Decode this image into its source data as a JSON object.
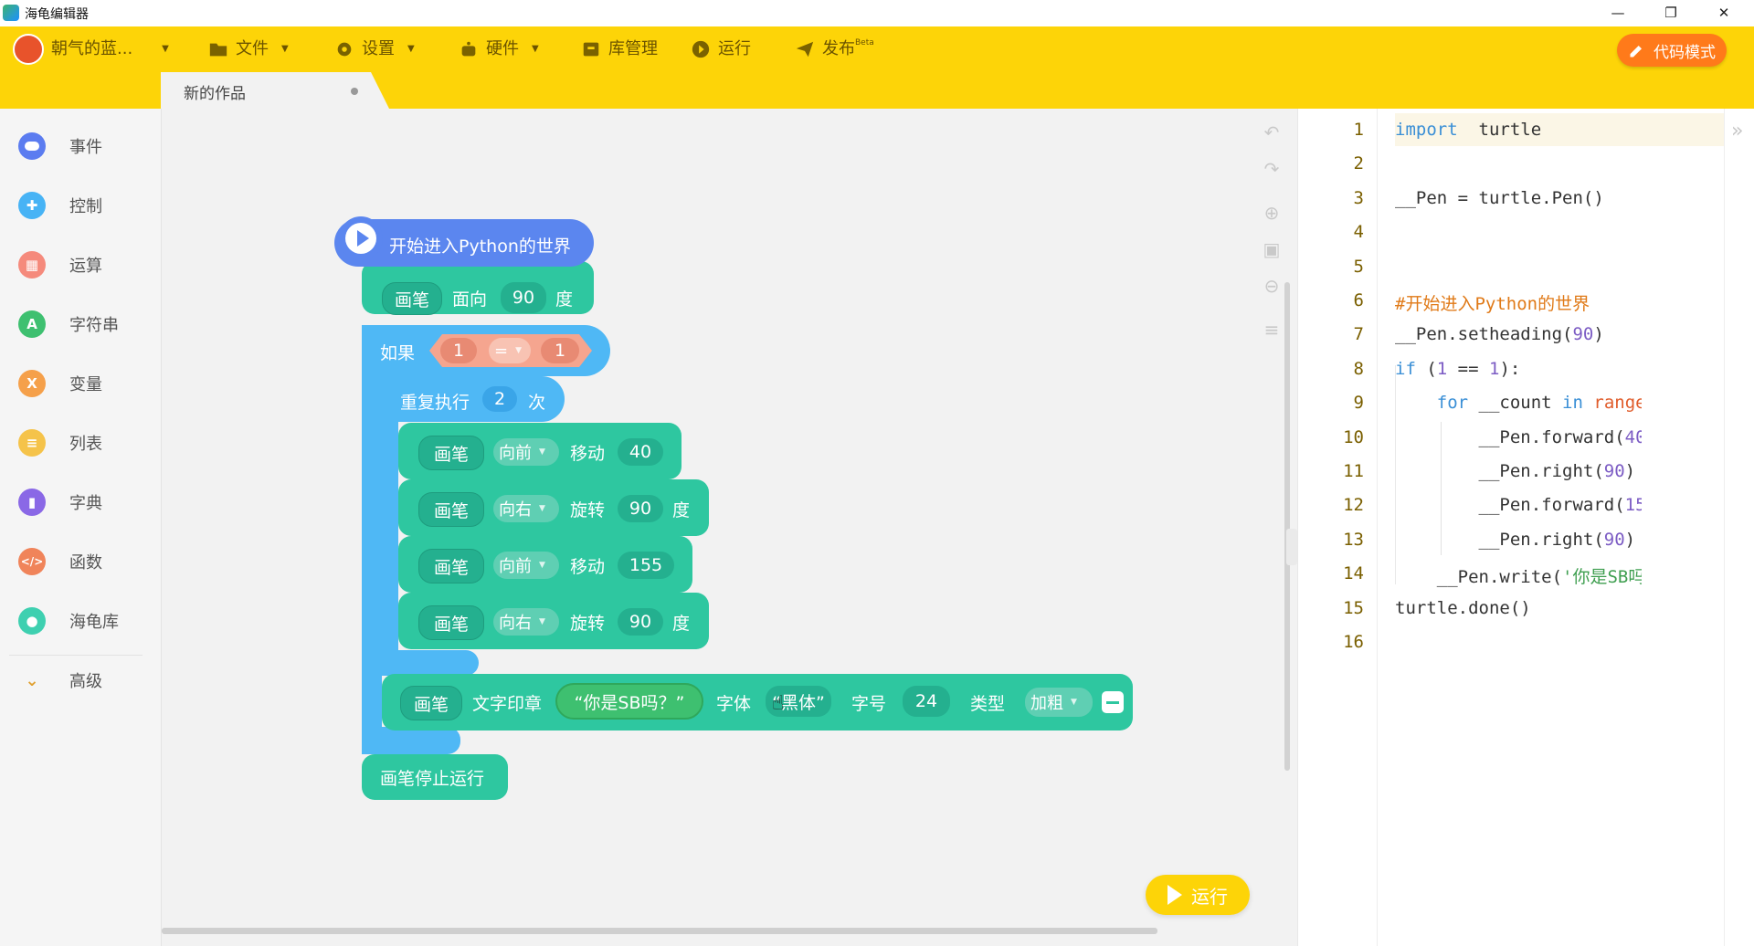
{
  "window": {
    "title": "海龟编辑器",
    "controls": [
      "—",
      "❐",
      "✕"
    ]
  },
  "toolbar": {
    "user_name": "朝气的蓝...",
    "file_label": "文件",
    "settings_label": "设置",
    "hardware_label": "硬件",
    "library_label": "库管理",
    "run_label": "运行",
    "publish_label": "发布",
    "publish_badge": "Beta",
    "code_mode_label": "代码模式",
    "accent_color": "#fdd408"
  },
  "tab": {
    "label": "新的作品"
  },
  "sidebar": {
    "items": [
      {
        "label": "事件",
        "color": "#5b7cf0",
        "icon": "toggle-icon"
      },
      {
        "label": "控制",
        "color": "#47b3f5",
        "icon": "gamepad-icon"
      },
      {
        "label": "运算",
        "color": "#f58a7c",
        "icon": "calculator-icon"
      },
      {
        "label": "字符串",
        "color": "#3ec070",
        "icon": "letter-a-icon"
      },
      {
        "label": "变量",
        "color": "#f5a04a",
        "icon": "x-variable-icon"
      },
      {
        "label": "列表",
        "color": "#f5c34a",
        "icon": "list-icon"
      },
      {
        "label": "字典",
        "color": "#8a68e6",
        "icon": "book-icon"
      },
      {
        "label": "函数",
        "color": "#f0845a",
        "icon": "code-icon"
      },
      {
        "label": "海龟库",
        "color": "#3ed0b0",
        "icon": "turtle-icon"
      },
      {
        "label": "高级",
        "color": "#e0a030",
        "icon": "chevron-down-icon"
      }
    ]
  },
  "blocks": {
    "hat": "开始进入Python的世界",
    "heading": {
      "pen": "画笔",
      "face": "面向",
      "value": "90",
      "unit": "度"
    },
    "if": {
      "label": "如果",
      "left": "1",
      "op": "=",
      "right": "1"
    },
    "repeat": {
      "label": "重复执行",
      "times": "2",
      "unit": "次"
    },
    "moves": [
      {
        "pen": "画笔",
        "dir": "向前",
        "action": "移动",
        "value": "40",
        "unit": ""
      },
      {
        "pen": "画笔",
        "dir": "向右",
        "action": "旋转",
        "value": "90",
        "unit": "度"
      },
      {
        "pen": "画笔",
        "dir": "向前",
        "action": "移动",
        "value": "155",
        "unit": ""
      },
      {
        "pen": "画笔",
        "dir": "向右",
        "action": "旋转",
        "value": "90",
        "unit": "度"
      }
    ],
    "write": {
      "pen": "画笔",
      "label": "文字印章",
      "text": "“你是SB吗？”",
      "font_label": "字体",
      "font": "“黑体”",
      "size_label": "字号",
      "size": "24",
      "type_label": "类型",
      "type": "加粗"
    },
    "stop": "画笔停止运行"
  },
  "code": {
    "line_numbers": [
      "1",
      "2",
      "3",
      "4",
      "5",
      "6",
      "7",
      "8",
      "9",
      "10",
      "11",
      "12",
      "13",
      "14",
      "15",
      "16"
    ]
  },
  "run_button": {
    "label": "运行"
  }
}
